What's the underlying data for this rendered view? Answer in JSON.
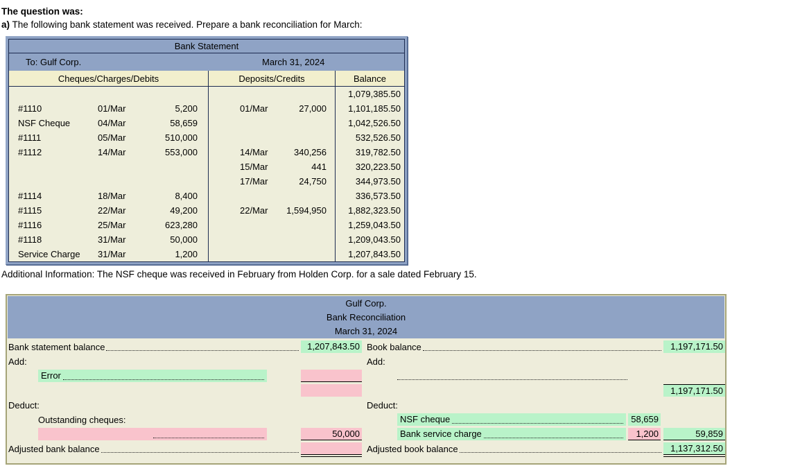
{
  "page": {
    "question_label": "The question was:",
    "question_part": "a)",
    "question_text": "The following bank statement was received. Prepare a bank reconciliation for March:",
    "additional_info": "Additional Information: The NSF cheque was received in February from Holden Corp. for a sale dated February 15."
  },
  "bank_statement": {
    "title": "Bank Statement",
    "to": "To: Gulf Corp.",
    "date": "March 31, 2024",
    "columns": [
      "Cheques/Charges/Debits",
      "Deposits/Credits",
      "Balance"
    ],
    "rows": [
      {
        "desc": "",
        "cdate": "",
        "camt": "",
        "ddate": "",
        "damt": "",
        "balance": "1,079,385.50"
      },
      {
        "desc": "#1110",
        "cdate": "01/Mar",
        "camt": "5,200",
        "ddate": "01/Mar",
        "damt": "27,000",
        "balance": "1,101,185.50"
      },
      {
        "desc": "NSF Cheque",
        "cdate": "04/Mar",
        "camt": "58,659",
        "ddate": "",
        "damt": "",
        "balance": "1,042,526.50"
      },
      {
        "desc": "#1111",
        "cdate": "05/Mar",
        "camt": "510,000",
        "ddate": "",
        "damt": "",
        "balance": "532,526.50"
      },
      {
        "desc": "#1112",
        "cdate": "14/Mar",
        "camt": "553,000",
        "ddate": "14/Mar",
        "damt": "340,256",
        "balance": "319,782.50"
      },
      {
        "desc": "",
        "cdate": "",
        "camt": "",
        "ddate": "15/Mar",
        "damt": "441",
        "balance": "320,223.50"
      },
      {
        "desc": "",
        "cdate": "",
        "camt": "",
        "ddate": "17/Mar",
        "damt": "24,750",
        "balance": "344,973.50"
      },
      {
        "desc": "#1114",
        "cdate": "18/Mar",
        "camt": "8,400",
        "ddate": "",
        "damt": "",
        "balance": "336,573.50"
      },
      {
        "desc": "#1115",
        "cdate": "22/Mar",
        "camt": "49,200",
        "ddate": "22/Mar",
        "damt": "1,594,950",
        "balance": "1,882,323.50"
      },
      {
        "desc": "#1116",
        "cdate": "25/Mar",
        "camt": "623,280",
        "ddate": "",
        "damt": "",
        "balance": "1,259,043.50"
      },
      {
        "desc": "#1118",
        "cdate": "31/Mar",
        "camt": "50,000",
        "ddate": "",
        "damt": "",
        "balance": "1,209,043.50"
      },
      {
        "desc": "Service Charge",
        "cdate": "31/Mar",
        "camt": "1,200",
        "ddate": "",
        "damt": "",
        "balance": "1,207,843.50"
      }
    ]
  },
  "reconciliation": {
    "company": "Gulf Corp.",
    "title": "Bank Reconciliation",
    "date": "March 31, 2024",
    "left": {
      "balance_label": "Bank statement balance",
      "balance_value": "1,207,843.50",
      "add_label": "Add:",
      "error_label": "Error",
      "deduct_label": "Deduct:",
      "outstanding_label": "Outstanding cheques:",
      "outstanding_value": "50,000",
      "adjusted_label": "Adjusted bank balance"
    },
    "right": {
      "balance_label": "Book balance",
      "balance_value": "1,197,171.50",
      "add_label": "Add:",
      "subtotal_value": "1,197,171.50",
      "deduct_label": "Deduct:",
      "nsf_label": "NSF cheque",
      "nsf_value": "58,659",
      "service_label": "Bank service charge",
      "service_value": "1,200",
      "deduct_total": "59,859",
      "adjusted_label": "Adjusted book balance",
      "adjusted_value": "1,137,312.50"
    }
  },
  "colors": {
    "header_blue": "#8fa3c5",
    "navy_line": "#1c2b50",
    "panel_beige": "#eeeddb",
    "statement_cream": "#f2efcd",
    "cell_green": "#b9f3c9",
    "cell_pink": "#f9c3cc"
  }
}
